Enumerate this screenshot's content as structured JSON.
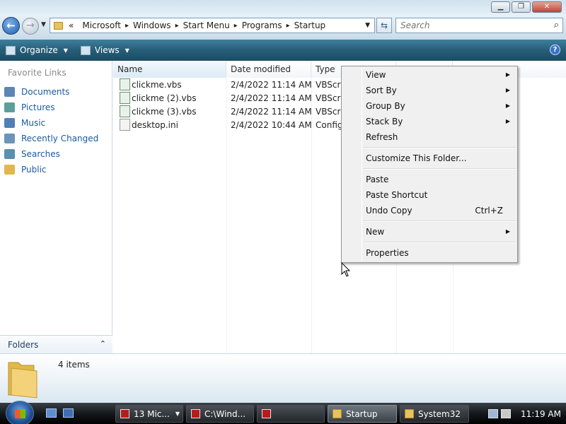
{
  "window": {
    "minimize_label": "▁",
    "maximize_label": "❐",
    "close_label": "✕"
  },
  "address": {
    "overflow": "«",
    "crumbs": [
      "Microsoft",
      "Windows",
      "Start Menu",
      "Programs",
      "Startup"
    ],
    "refresh_icon": "refresh-icon"
  },
  "search": {
    "placeholder": "Search"
  },
  "toolbar": {
    "organize_label": "Organize",
    "views_label": "Views",
    "help_label": "?"
  },
  "nav": {
    "title": "Favorite Links",
    "links": [
      {
        "label": "Documents",
        "icon": "documents-icon",
        "color": "#5b86b6"
      },
      {
        "label": "Pictures",
        "icon": "pictures-icon",
        "color": "#5b9e9a"
      },
      {
        "label": "Music",
        "icon": "music-icon",
        "color": "#4f7fb8"
      },
      {
        "label": "Recently Changed",
        "icon": "recent-icon",
        "color": "#6d93b8"
      },
      {
        "label": "Searches",
        "icon": "searches-icon",
        "color": "#5a8fb0"
      },
      {
        "label": "Public",
        "icon": "public-folder-icon",
        "color": "#e1b84b"
      }
    ],
    "folders_label": "Folders"
  },
  "columns": {
    "name": "Name",
    "date": "Date modified",
    "type": "Type"
  },
  "files": [
    {
      "name": "clickme.vbs",
      "date": "2/4/2022 11:14 AM",
      "type": "VBScrip"
    },
    {
      "name": "clickme (2).vbs",
      "date": "2/4/2022 11:14 AM",
      "type": "VBScrip"
    },
    {
      "name": "clickme (3).vbs",
      "date": "2/4/2022 11:14 AM",
      "type": "VBScrip"
    },
    {
      "name": "desktop.ini",
      "date": "2/4/2022 10:44 AM",
      "type": "Config"
    }
  ],
  "context_menu": {
    "view": "View",
    "sort_by": "Sort By",
    "group_by": "Group By",
    "stack_by": "Stack By",
    "refresh": "Refresh",
    "customize": "Customize This Folder...",
    "paste": "Paste",
    "paste_shortcut": "Paste Shortcut",
    "undo_copy": "Undo Copy",
    "undo_shortcut": "Ctrl+Z",
    "new": "New",
    "properties": "Properties"
  },
  "details": {
    "count": "4 items"
  },
  "taskbar": {
    "tasks": [
      {
        "label": "13 Mic...",
        "icon": "red"
      },
      {
        "label": "C:\\Wind...",
        "icon": "red"
      },
      {
        "label": "",
        "icon": "red"
      },
      {
        "label": "Startup",
        "icon": "fold"
      },
      {
        "label": "System32",
        "icon": "fold"
      }
    ],
    "clock": "11:19 AM"
  },
  "colors": {
    "toolbar": "#275e78",
    "link_text": "#1a5a9e",
    "taskbar": "#15181c"
  }
}
